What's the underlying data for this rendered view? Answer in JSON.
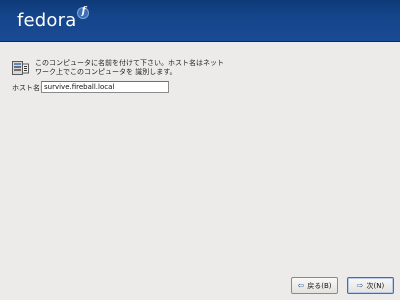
{
  "banner": {
    "logo_text": "fedora",
    "logo_mark": "f",
    "brand_color": "#1a4b94"
  },
  "hostname_screen": {
    "icon": "network-card-icon",
    "description_line1": "このコンピュータに名前を付けて下さい。ホスト名はネット",
    "description_line2": "ワーク上でこのコンピュータを 識別します。",
    "hostname_label": "ホスト名:",
    "hostname_value": "survive.fireball.local"
  },
  "buttons": {
    "back_label": "戻る(B)",
    "back_icon": "left-arrow-icon",
    "next_label": "次(N)",
    "next_icon": "right-arrow-icon"
  }
}
